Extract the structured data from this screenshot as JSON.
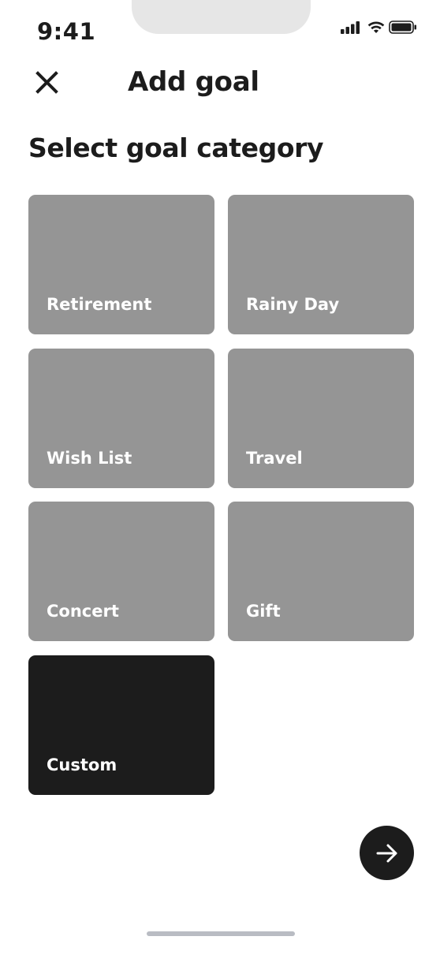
{
  "status_bar": {
    "time": "9:41",
    "icons": [
      "cellular-signal-icon",
      "wifi-icon",
      "battery-icon"
    ]
  },
  "header": {
    "title": "Add goal",
    "close_icon": "close-icon"
  },
  "section_title": "Select goal category",
  "categories": [
    {
      "label": "Retirement",
      "selected": false
    },
    {
      "label": "Rainy Day",
      "selected": false
    },
    {
      "label": "Wish List",
      "selected": false
    },
    {
      "label": "Travel",
      "selected": false
    },
    {
      "label": "Concert",
      "selected": false
    },
    {
      "label": "Gift",
      "selected": false
    },
    {
      "label": "Custom",
      "selected": true
    }
  ],
  "next_button": {
    "icon": "arrow-right-icon"
  },
  "colors": {
    "tile": "#959595",
    "tile_selected": "#1c1c1c",
    "text_primary": "#1c1c1c",
    "background": "#ffffff"
  }
}
